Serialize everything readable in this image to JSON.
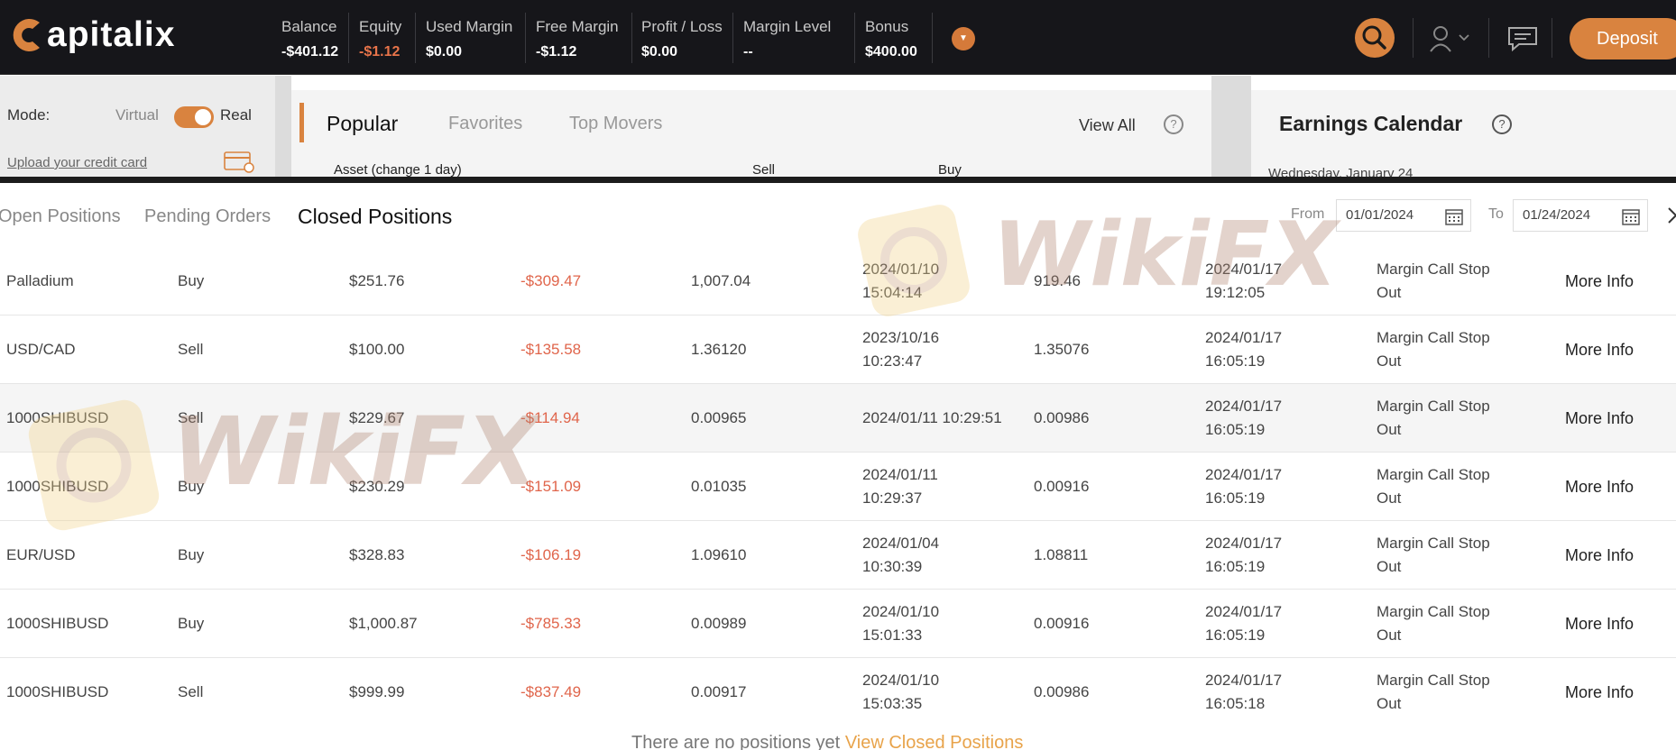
{
  "brand": {
    "name": "apitalix"
  },
  "header": {
    "stats": [
      {
        "label": "Balance",
        "value": "-$401.12"
      },
      {
        "label": "Equity",
        "value": "-$1.12"
      },
      {
        "label": "Used Margin",
        "value": "$0.00"
      },
      {
        "label": "Free Margin",
        "value": "-$1.12"
      },
      {
        "label": "Profit / Loss",
        "value": "$0.00"
      },
      {
        "label": "Margin Level",
        "value": "--"
      },
      {
        "label": "Bonus",
        "value": "$400.00"
      }
    ],
    "deposit_label": "Deposit"
  },
  "mode": {
    "label": "Mode:",
    "virtual": "Virtual",
    "real": "Real",
    "selected": "Real"
  },
  "upload_link": "Upload your credit card",
  "popular": {
    "tabs": [
      "Popular",
      "Favorites",
      "Top Movers"
    ],
    "view_all": "View All",
    "columns": [
      "Asset (change 1 day)",
      "Sell",
      "Buy"
    ]
  },
  "earnings": {
    "title": "Earnings Calendar",
    "date": "Wednesday, January 24"
  },
  "positions": {
    "tabs": [
      "Open Positions",
      "Pending Orders",
      "Closed Positions"
    ],
    "active_tab": "Closed Positions",
    "from_label": "From",
    "from_date": "01/01/2024",
    "to_label": "To",
    "to_date": "01/24/2024",
    "rows": [
      {
        "asset": "Palladium",
        "side": "Buy",
        "amount": "$251.76",
        "pl": "-$309.47",
        "open_price": "1,007.04",
        "open_time": [
          "2024/01/10",
          "15:04:14"
        ],
        "close_price": "919.46",
        "close_time": [
          "2024/01/17",
          "19:12:05"
        ],
        "reason": [
          "Margin Call Stop",
          "Out"
        ],
        "action": "More Info"
      },
      {
        "asset": "USD/CAD",
        "side": "Sell",
        "amount": "$100.00",
        "pl": "-$135.58",
        "open_price": "1.36120",
        "open_time": [
          "2023/10/16",
          "10:23:47"
        ],
        "close_price": "1.35076",
        "close_time": [
          "2024/01/17",
          "16:05:19"
        ],
        "reason": [
          "Margin Call Stop",
          "Out"
        ],
        "action": "More Info"
      },
      {
        "asset": "1000SHIBUSD",
        "side": "Sell",
        "amount": "$229.67",
        "pl": "-$114.94",
        "open_price": "0.00965",
        "open_time": [
          "2024/01/11 10:29:51",
          ""
        ],
        "close_price": "0.00986",
        "close_time": [
          "2024/01/17",
          "16:05:19"
        ],
        "reason": [
          "Margin Call Stop",
          "Out"
        ],
        "action": "More Info"
      },
      {
        "asset": "1000SHIBUSD",
        "side": "Buy",
        "amount": "$230.29",
        "pl": "-$151.09",
        "open_price": "0.01035",
        "open_time": [
          "2024/01/11",
          "10:29:37"
        ],
        "close_price": "0.00916",
        "close_time": [
          "2024/01/17",
          "16:05:19"
        ],
        "reason": [
          "Margin Call Stop",
          "Out"
        ],
        "action": "More Info"
      },
      {
        "asset": "EUR/USD",
        "side": "Buy",
        "amount": "$328.83",
        "pl": "-$106.19",
        "open_price": "1.09610",
        "open_time": [
          "2024/01/04",
          "10:30:39"
        ],
        "close_price": "1.08811",
        "close_time": [
          "2024/01/17",
          "16:05:19"
        ],
        "reason": [
          "Margin Call Stop",
          "Out"
        ],
        "action": "More Info"
      },
      {
        "asset": "1000SHIBUSD",
        "side": "Buy",
        "amount": "$1,000.87",
        "pl": "-$785.33",
        "open_price": "0.00989",
        "open_time": [
          "2024/01/10",
          "15:01:33"
        ],
        "close_price": "0.00916",
        "close_time": [
          "2024/01/17",
          "16:05:19"
        ],
        "reason": [
          "Margin Call Stop",
          "Out"
        ],
        "action": "More Info"
      },
      {
        "asset": "1000SHIBUSD",
        "side": "Sell",
        "amount": "$999.99",
        "pl": "-$837.49",
        "open_price": "0.00917",
        "open_time": [
          "2024/01/10",
          "15:03:35"
        ],
        "close_price": "0.00986",
        "close_time": [
          "2024/01/17",
          "16:05:18"
        ],
        "reason": [
          "Margin Call Stop",
          "Out"
        ],
        "action": "More Info"
      }
    ],
    "empty_message": "There are no positions yet",
    "empty_link": "View Closed Positions"
  },
  "watermark": "WikiFX",
  "colors": {
    "accent": "#d9833f",
    "loss": "#e0654b",
    "topbar": "#16161a"
  }
}
